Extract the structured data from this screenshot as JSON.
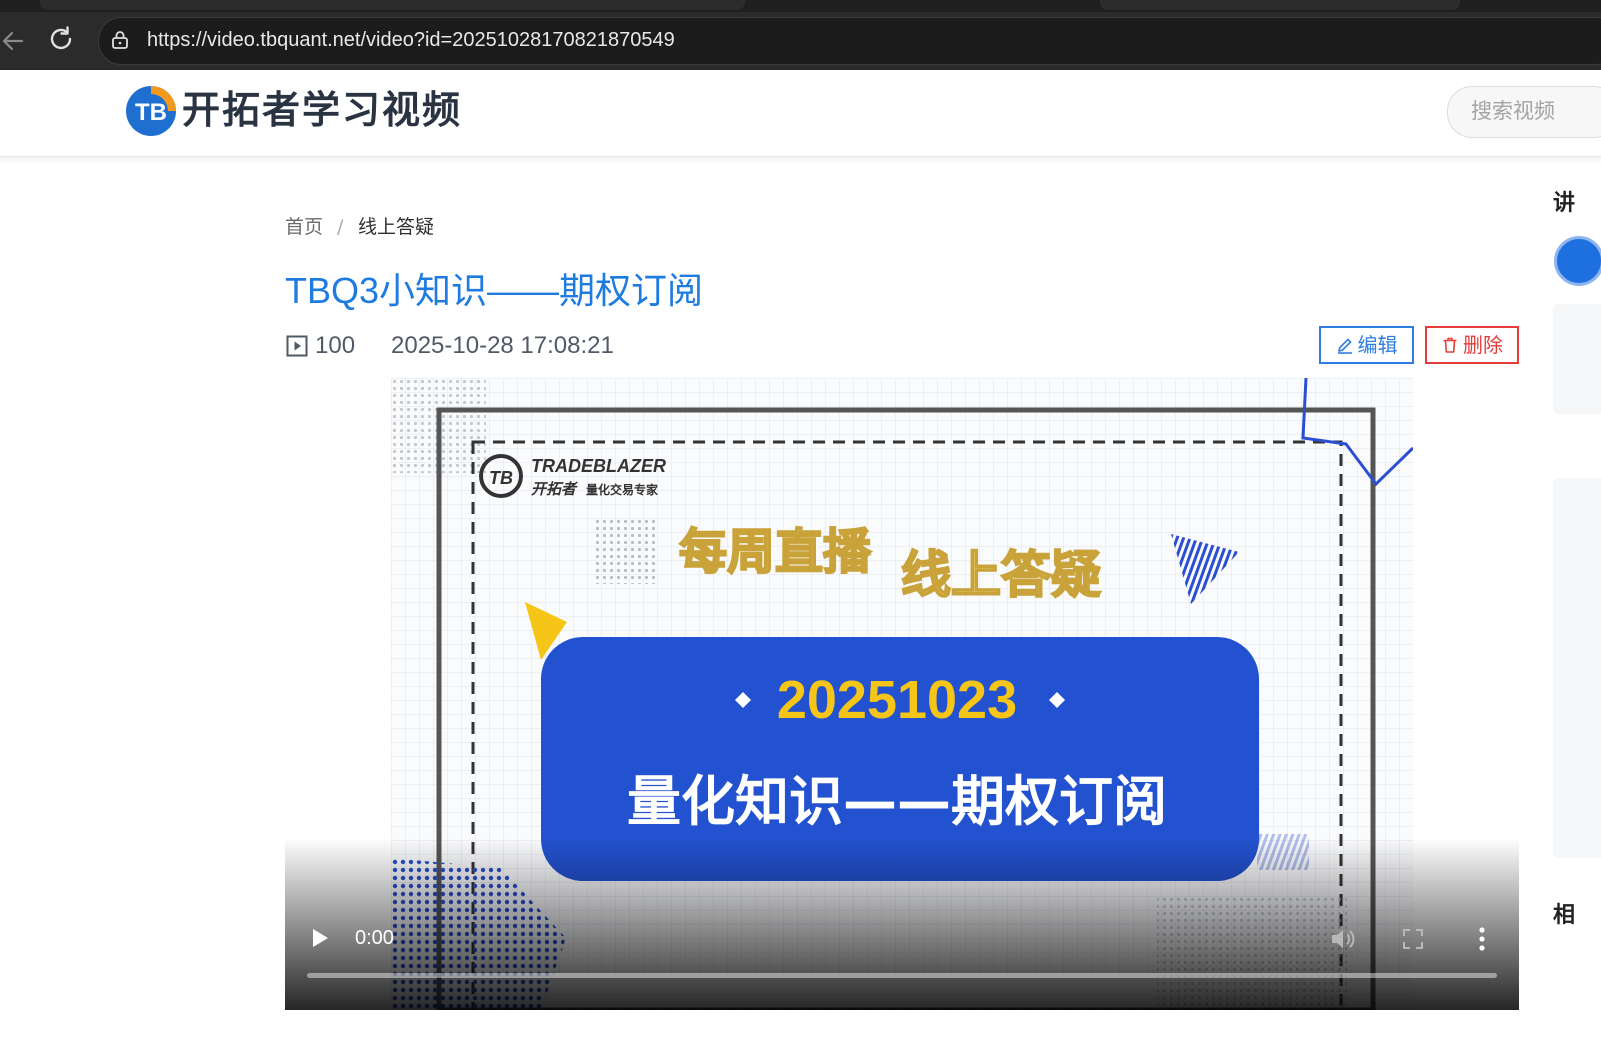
{
  "browser": {
    "url": "https://video.tbquant.net/video?id=20251028170821870549"
  },
  "header": {
    "logo_text": "开拓者学习视频",
    "search_placeholder": "搜索视频"
  },
  "breadcrumb": {
    "home": "首页",
    "separator": "/",
    "current": "线上答疑"
  },
  "video": {
    "title": "TBQ3小知识——期权订阅",
    "play_count": "100",
    "publish_time": "2025-10-28 17:08:21",
    "current_time": "0:00",
    "thumbnail": {
      "brand": "TRADEBLAZER",
      "brand_cn": "开拓者",
      "brand_tag": "量化交易专家",
      "tag_left": "每周直播",
      "tag_right": "线上答疑",
      "date": "20251023",
      "topic": "量化知识——期权订阅"
    }
  },
  "actions": {
    "edit_label": "编辑",
    "delete_label": "删除"
  },
  "sidebar": {
    "heading_top": "讲",
    "heading_bottom": "相"
  },
  "colors": {
    "title_blue": "#1e7be0",
    "edit_blue": "#2f7de1",
    "delete_red": "#e53b3b",
    "thumb_blue": "#2352d0",
    "thumb_yellow": "#f5c518"
  }
}
